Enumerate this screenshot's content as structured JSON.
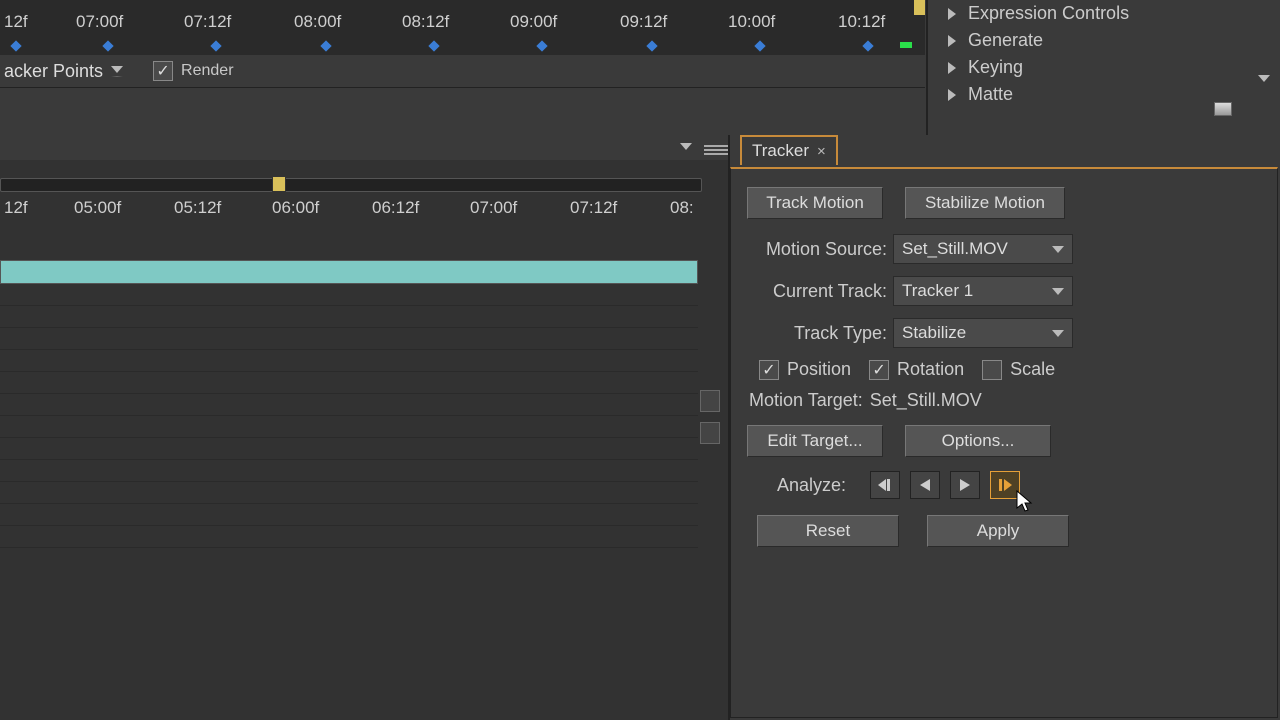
{
  "timeline_top": {
    "marks": [
      "12f",
      "07:00f",
      "07:12f",
      "08:00f",
      "08:12f",
      "09:00f",
      "09:12f",
      "10:00f",
      "10:12f"
    ],
    "tracker_points_label": "acker Points",
    "render_label": "Render"
  },
  "effects": {
    "items": [
      "Expression Controls",
      "Generate",
      "Keying",
      "Matte"
    ]
  },
  "timeline_lower": {
    "marks": [
      "12f",
      "05:00f",
      "05:12f",
      "06:00f",
      "06:12f",
      "07:00f",
      "07:12f",
      "08:"
    ]
  },
  "tracker": {
    "tab": "Tracker",
    "track_motion": "Track Motion",
    "stabilize_motion": "Stabilize Motion",
    "motion_source_label": "Motion Source:",
    "motion_source_value": "Set_Still.MOV",
    "current_track_label": "Current Track:",
    "current_track_value": "Tracker 1",
    "track_type_label": "Track Type:",
    "track_type_value": "Stabilize",
    "position_label": "Position",
    "rotation_label": "Rotation",
    "scale_label": "Scale",
    "motion_target_label": "Motion Target:",
    "motion_target_value": "Set_Still.MOV",
    "edit_target": "Edit Target...",
    "options": "Options...",
    "analyze_label": "Analyze:",
    "reset": "Reset",
    "apply": "Apply"
  }
}
